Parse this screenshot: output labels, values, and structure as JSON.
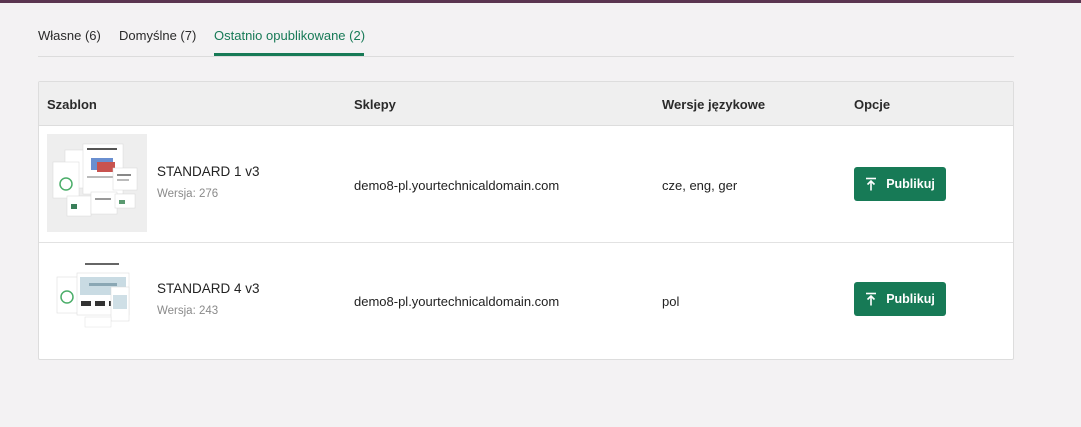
{
  "tabs": [
    {
      "label": "Własne (6)"
    },
    {
      "label": "Domyślne (7)"
    },
    {
      "label": "Ostatnio opublikowane (2)",
      "active": true
    }
  ],
  "table": {
    "headers": [
      "Szablon",
      "Sklepy",
      "Wersje językowe",
      "Opcje"
    ],
    "rows": [
      {
        "name": "STANDARD 1 v3",
        "version": "Wersja: 276",
        "shop": "demo8-pl.yourtechnicaldomain.com",
        "languages": "cze, eng, ger",
        "action_label": "Publikuj"
      },
      {
        "name": "STANDARD 4 v3",
        "version": "Wersja: 243",
        "shop": "demo8-pl.yourtechnicaldomain.com",
        "languages": "pol",
        "action_label": "Publikuj"
      }
    ]
  },
  "icons": {
    "publish": "upload-arrow-icon"
  },
  "colors": {
    "accent": "#177a56",
    "top_strip": "#5a3550",
    "background": "#f3f2f3"
  }
}
